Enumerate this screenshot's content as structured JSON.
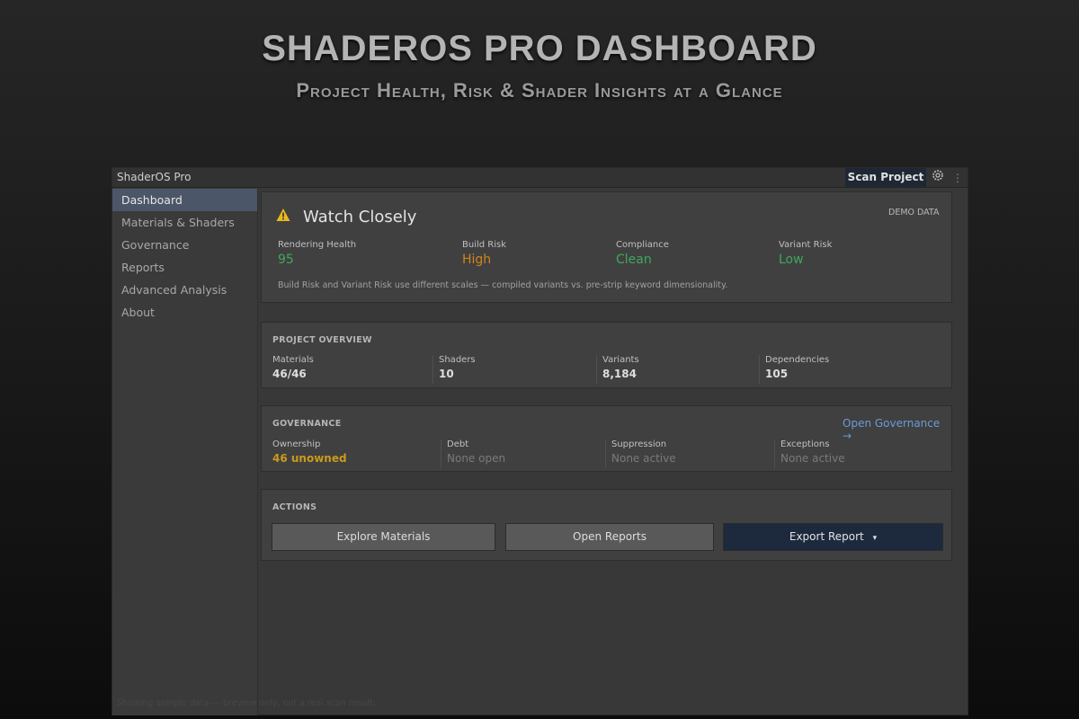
{
  "hero": {
    "title": "SHADEROS PRO DASHBOARD",
    "subtitle": "Project Health, Risk & Shader Insights at a Glance"
  },
  "titlebar": {
    "app_name": "ShaderOS Pro",
    "scan_label": "Scan Project",
    "gear_icon": "gear-icon",
    "more_icon": "more-vertical-icon"
  },
  "sidebar": {
    "items": [
      {
        "label": "Dashboard",
        "active": true
      },
      {
        "label": "Materials & Shaders",
        "active": false
      },
      {
        "label": "Governance",
        "active": false
      },
      {
        "label": "Reports",
        "active": false
      },
      {
        "label": "Advanced Analysis",
        "active": false
      },
      {
        "label": "About",
        "active": false
      }
    ]
  },
  "status": {
    "icon": "warning-icon",
    "title": "Watch Closely",
    "tag": "DEMO DATA",
    "metrics": [
      {
        "label": "Rendering Health",
        "value": "95",
        "color": "#3fa85b"
      },
      {
        "label": "Build Risk",
        "value": "High",
        "color": "#d0851c"
      },
      {
        "label": "Compliance",
        "value": "Clean",
        "color": "#3fa85b"
      },
      {
        "label": "Variant Risk",
        "value": "Low",
        "color": "#3fa85b"
      }
    ],
    "note": "Build Risk and Variant Risk use different scales — compiled variants vs. pre-strip keyword dimensionality."
  },
  "overview": {
    "label": "PROJECT OVERVIEW",
    "items": [
      {
        "label": "Materials",
        "value": "46/46"
      },
      {
        "label": "Shaders",
        "value": "10"
      },
      {
        "label": "Variants",
        "value": "8,184"
      },
      {
        "label": "Dependencies",
        "value": "105"
      }
    ]
  },
  "governance": {
    "label": "GOVERNANCE",
    "link": "Open Governance →",
    "items": [
      {
        "label": "Ownership",
        "value": "46 unowned",
        "color": "#c99a1c"
      },
      {
        "label": "Debt",
        "value": "None open",
        "color": "#7a7a7a"
      },
      {
        "label": "Suppression",
        "value": "None active",
        "color": "#7a7a7a"
      },
      {
        "label": "Exceptions",
        "value": "None active",
        "color": "#7a7a7a"
      }
    ]
  },
  "actions": {
    "label": "ACTIONS",
    "explore": "Explore Materials",
    "reports": "Open Reports",
    "export": "Export Report",
    "export_caret": "▾"
  },
  "footer": {
    "note": "Showing sample data — preview only, not a real scan result."
  },
  "colors": {
    "accent": "#4b5668",
    "primary_button": "#1d2a3e",
    "link": "#6b9ad8",
    "good": "#3fa85b",
    "warn": "#d0851c"
  }
}
